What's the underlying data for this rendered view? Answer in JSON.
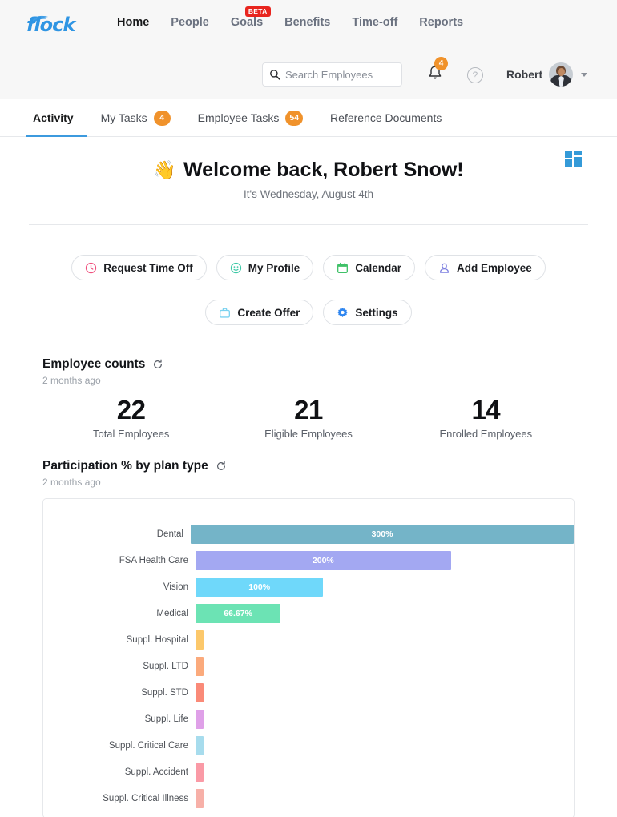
{
  "brand": {
    "logo_text": "flock",
    "logo_color": "#2f95e3"
  },
  "nav": {
    "items": [
      {
        "label": "Home",
        "active": true,
        "badge": ""
      },
      {
        "label": "People",
        "active": false,
        "badge": ""
      },
      {
        "label": "Goals",
        "active": false,
        "badge": "BETA"
      },
      {
        "label": "Benefits",
        "active": false,
        "badge": ""
      },
      {
        "label": "Time-off",
        "active": false,
        "badge": ""
      },
      {
        "label": "Reports",
        "active": false,
        "badge": ""
      }
    ]
  },
  "search": {
    "placeholder": "Search Employees",
    "value": "",
    "icon": "search-icon"
  },
  "notifications": {
    "count": "4",
    "icon": "bell-icon"
  },
  "help": {
    "icon": "help-circle-icon",
    "glyph": "?"
  },
  "user": {
    "name": "Robert",
    "icon": "avatar",
    "caret": "chevron-down-icon"
  },
  "tabs": [
    {
      "label": "Activity",
      "badge": "",
      "active": true
    },
    {
      "label": "My Tasks",
      "badge": "4",
      "active": false
    },
    {
      "label": "Employee Tasks",
      "badge": "54",
      "active": false
    },
    {
      "label": "Reference Documents",
      "badge": "",
      "active": false
    }
  ],
  "welcome": {
    "wave": "👋",
    "title": "Welcome back, Robert Snow!",
    "subtitle": "It's Wednesday, August 4th",
    "grid_icon": "dashboard-grid-icon"
  },
  "actions": {
    "row1": [
      {
        "label": "Request Time Off",
        "icon": "clock-icon",
        "color": "#f0527f"
      },
      {
        "label": "My Profile",
        "icon": "smiley-icon",
        "color": "#3ec9a7"
      },
      {
        "label": "Calendar",
        "icon": "calendar-icon",
        "color": "#3fc168"
      },
      {
        "label": "Add Employee",
        "icon": "person-add-icon",
        "color": "#7b7ee0"
      }
    ],
    "row2": [
      {
        "label": "Create Offer",
        "icon": "briefcase-icon",
        "color": "#7bd2f0"
      },
      {
        "label": "Settings",
        "icon": "gear-icon",
        "color": "#2f86f0"
      }
    ]
  },
  "employee_counts": {
    "title": "Employee counts",
    "updated": "2 months ago",
    "refresh_icon": "refresh-icon",
    "cells": [
      {
        "value": "22",
        "label": "Total Employees"
      },
      {
        "value": "21",
        "label": "Eligible Employees"
      },
      {
        "value": "14",
        "label": "Enrolled Employees"
      }
    ]
  },
  "participation": {
    "title": "Participation % by plan type",
    "updated": "2 months ago",
    "refresh_icon": "refresh-icon"
  },
  "chart_data": {
    "type": "bar",
    "orientation": "horizontal",
    "title": "Participation % by plan type",
    "xlabel": "",
    "ylabel": "",
    "grid": false,
    "legend": false,
    "xlim": [
      0,
      300
    ],
    "categories": [
      "Dental",
      "FSA Health Care",
      "Vision",
      "Medical",
      "Suppl. Hospital",
      "Suppl. LTD",
      "Suppl. STD",
      "Suppl. Life",
      "Suppl. Critical Care",
      "Suppl. Accident",
      "Suppl. Critical Illness"
    ],
    "values": [
      300,
      200,
      100,
      66.67,
      2,
      2,
      2,
      2,
      2,
      2,
      2
    ],
    "labels": [
      "300%",
      "200%",
      "100%",
      "66.67%",
      "",
      "",
      "",
      "",
      "",
      "",
      ""
    ],
    "colors": [
      "#74b4c8",
      "#a3a8f2",
      "#6fd8fa",
      "#6ce3b4",
      "#fcc86b",
      "#fbaa7c",
      "#fa8a78",
      "#dfa0e8",
      "#a7dced",
      "#fa9aa6",
      "#f7b0a8"
    ]
  }
}
